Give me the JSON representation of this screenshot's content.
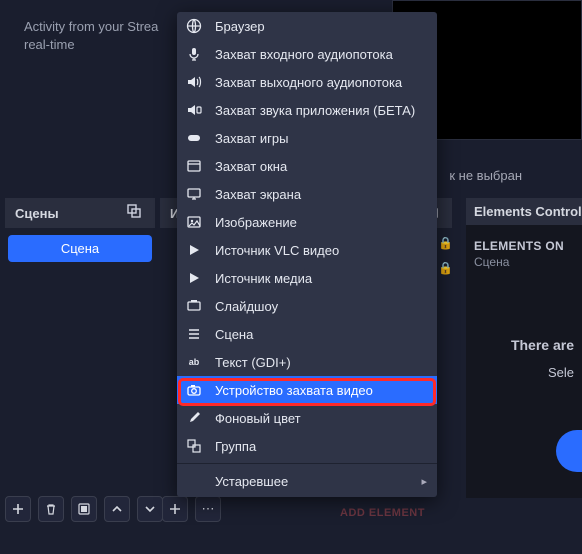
{
  "background": {
    "activity_text": "Activity from your Strea",
    "activity_text2": "real-time",
    "no_source": "к не выбран"
  },
  "scenes": {
    "header": "Сцены",
    "item": "Сцена"
  },
  "sources": {
    "header": "И"
  },
  "elements": {
    "header": "Elements Control",
    "on": "ELEMENTS ON",
    "scene": "Сцена",
    "there": "There are",
    "select": "Sele"
  },
  "add_element": "ADD ELEMENT",
  "menu": {
    "items": [
      {
        "id": "browser",
        "label": "Браузер"
      },
      {
        "id": "audio-in",
        "label": "Захват входного аудиопотока"
      },
      {
        "id": "audio-out",
        "label": "Захват выходного аудиопотока"
      },
      {
        "id": "app-audio",
        "label": "Захват звука приложения (БЕТА)"
      },
      {
        "id": "game",
        "label": "Захват игры"
      },
      {
        "id": "window",
        "label": "Захват окна"
      },
      {
        "id": "screen",
        "label": "Захват экрана"
      },
      {
        "id": "image",
        "label": "Изображение"
      },
      {
        "id": "vlc",
        "label": "Источник VLC видео"
      },
      {
        "id": "media",
        "label": "Источник медиа"
      },
      {
        "id": "slideshow",
        "label": "Слайдшоу"
      },
      {
        "id": "scene",
        "label": "Сцена"
      },
      {
        "id": "text",
        "label": "Текст (GDI+)"
      },
      {
        "id": "video-capture",
        "label": "Устройство захвата видео"
      },
      {
        "id": "color",
        "label": "Фоновый цвет"
      },
      {
        "id": "group",
        "label": "Группа"
      }
    ],
    "deprecated": "Устаревшее"
  }
}
